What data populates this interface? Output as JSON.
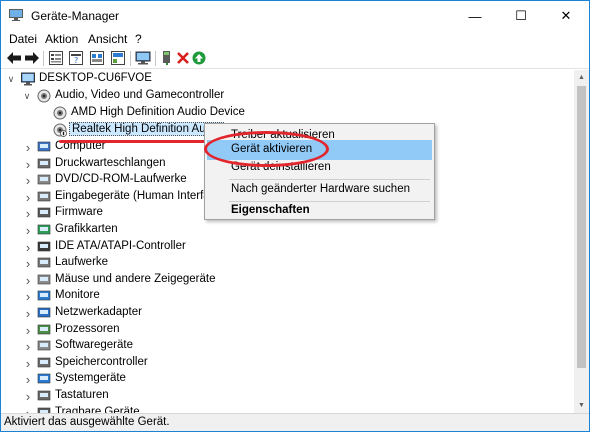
{
  "window": {
    "title": "Geräte-Manager"
  },
  "window_buttons": {
    "minimize": "—",
    "maximize": "☐",
    "close": "✕"
  },
  "menu": [
    "Datei",
    "Aktion",
    "Ansicht",
    "?"
  ],
  "toolbar_icons": [
    "back-arrow-icon",
    "forward-arrow-icon",
    "properties-icon",
    "help-icon",
    "view-icon",
    "update-driver-icon",
    "scan-hardware-icon",
    "add-legacy-icon",
    "uninstall-icon",
    "enable-device-icon"
  ],
  "tree": {
    "root": "DESKTOP-CU6FVOE",
    "audio_category": "Audio, Video und Gamecontroller",
    "audio_children": [
      "AMD High Definition Audio Device",
      "Realtek High Definition Audio"
    ],
    "categories": [
      "Computer",
      "Druckwarteschlangen",
      "DVD/CD-ROM-Laufwerke",
      "Eingabegeräte (Human Interface Devices)",
      "Firmware",
      "Grafikkarten",
      "IDE ATA/ATAPI-Controller",
      "Laufwerke",
      "Mäuse und andere Zeigegeräte",
      "Monitore",
      "Netzwerkadapter",
      "Prozessoren",
      "Softwaregeräte",
      "Speichercontroller",
      "Systemgeräte",
      "Tastaturen",
      "Tragbare Geräte"
    ]
  },
  "context_menu": {
    "items": [
      "Treiber aktualisieren",
      "Gerät aktivieren",
      "Gerät deinstallieren",
      "Nach geänderter Hardware suchen",
      "Eigenschaften"
    ],
    "highlighted_index": 1
  },
  "status": {
    "text": "Aktiviert das ausgewählte Gerät."
  },
  "colors": {
    "accent": "#1883d7",
    "highlight": "#91c9f7",
    "annotation": "#e2262d"
  }
}
